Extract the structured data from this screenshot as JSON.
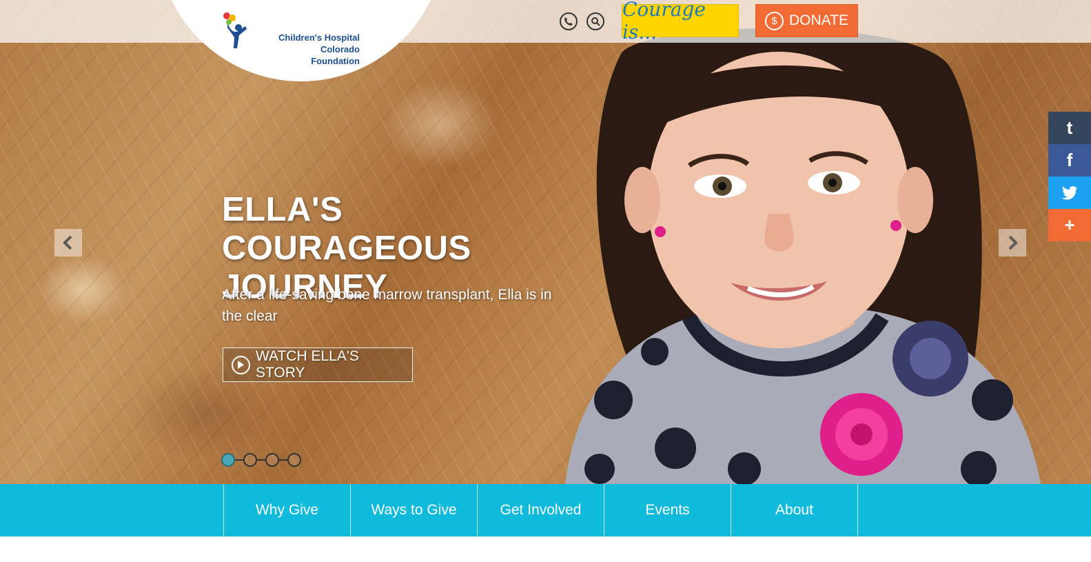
{
  "header": {
    "logo": {
      "line1": "Children's Hospital Colorado",
      "line2": "Foundation",
      "icon": "child-balloons-logo-icon"
    },
    "phone_icon": "phone-icon",
    "search_icon": "search-icon",
    "courage_label": "Courage is...",
    "donate_label": "DONATE",
    "donate_icon": "dollar-icon",
    "colors": {
      "courage_bg": "#ffd400",
      "donate_bg": "#f26b35"
    }
  },
  "hero": {
    "headline": "ELLA'S COURAGEOUS JOURNEY",
    "subline": "After a life-saving bone marrow transplant, Ella is in the clear",
    "cta_label": "WATCH ELLA'S STORY",
    "cta_icon": "play-icon",
    "prev_icon": "chevron-left-icon",
    "next_icon": "chevron-right-icon",
    "slides_total": 4,
    "active_slide": 1
  },
  "social": [
    {
      "label": "t",
      "icon": "tumblr-icon",
      "color": "#35465c"
    },
    {
      "label": "f",
      "icon": "facebook-icon",
      "color": "#3b5998"
    },
    {
      "label": "",
      "icon": "twitter-icon",
      "color": "#1da1f2"
    },
    {
      "label": "+",
      "icon": "share-plus-icon",
      "color": "#f26b35"
    }
  ],
  "nav": {
    "items": [
      "Why Give",
      "Ways to Give",
      "Get Involved",
      "Events",
      "About"
    ],
    "color": "#0fbadb"
  }
}
